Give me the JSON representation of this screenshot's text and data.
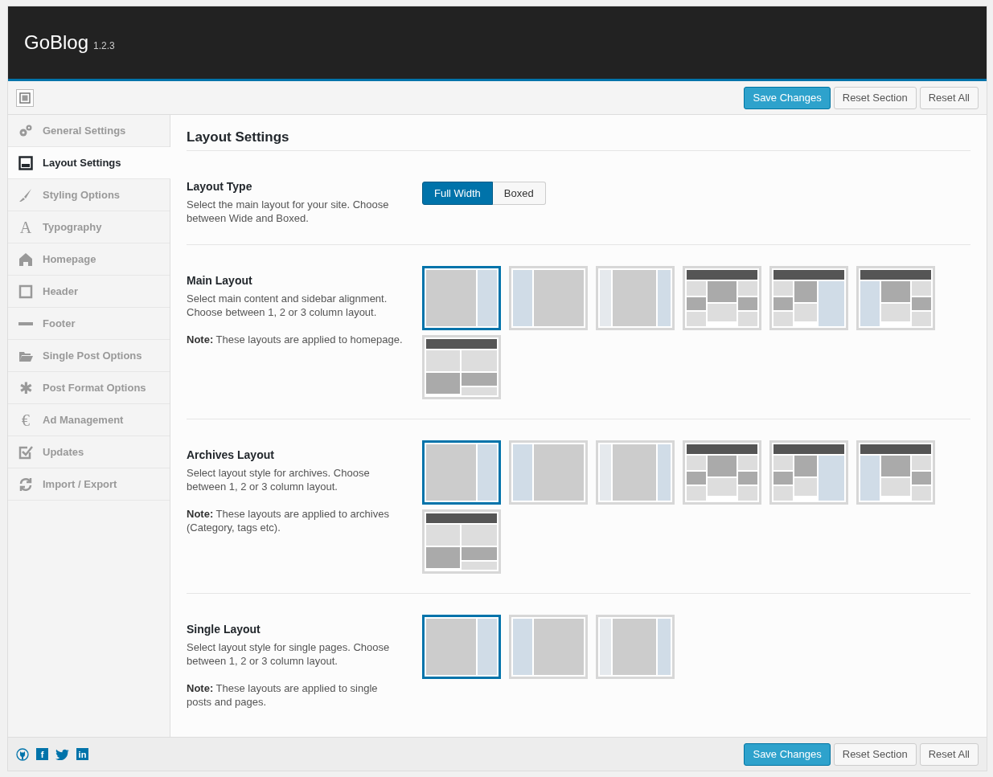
{
  "header": {
    "title": "GoBlog",
    "version": "1.2.3"
  },
  "toolbar": {
    "buttons": [
      {
        "label": "Save Changes",
        "kind": "primary"
      },
      {
        "label": "Reset Section",
        "kind": "secondary"
      },
      {
        "label": "Reset All",
        "kind": "secondary"
      }
    ]
  },
  "sidebar": {
    "items": [
      {
        "label": "General Settings",
        "kind": "gears",
        "selected": false
      },
      {
        "label": "Layout Settings",
        "kind": "layout",
        "selected": true
      },
      {
        "label": "Styling Options",
        "kind": "brush",
        "selected": false
      },
      {
        "label": "Typography",
        "kind": "glyph",
        "glyph": "A",
        "selected": false
      },
      {
        "label": "Homepage",
        "kind": "home",
        "selected": false
      },
      {
        "label": "Header",
        "kind": "square",
        "selected": false
      },
      {
        "label": "Footer",
        "kind": "minus",
        "selected": false
      },
      {
        "label": "Single Post Options",
        "kind": "folder",
        "selected": false
      },
      {
        "label": "Post Format Options",
        "kind": "glyph",
        "glyph": "✱",
        "selected": false
      },
      {
        "label": "Ad Management",
        "kind": "glyph",
        "glyph": "€",
        "selected": false
      },
      {
        "label": "Updates",
        "kind": "check",
        "selected": false
      },
      {
        "label": "Import / Export",
        "kind": "refresh",
        "selected": false
      }
    ]
  },
  "content": {
    "title": "Layout Settings",
    "sections": [
      {
        "title": "Layout Type",
        "description": "Select the main layout for your site. Choose between Wide and Boxed.",
        "kind": "toggle",
        "options": [
          {
            "label": "Full Width",
            "selected": true
          },
          {
            "label": "Boxed",
            "selected": false
          }
        ]
      },
      {
        "title": "Main Layout",
        "description": "Select main content and sidebar alignment. Choose between 1, 2 or 3 column layout.",
        "note": "**Note:** These layouts are applied to homepage.",
        "kind": "layouts",
        "options": [
          {
            "kind": "right-sidebar",
            "selected": true
          },
          {
            "kind": "left-sidebar",
            "selected": false
          },
          {
            "kind": "both-sidebars",
            "selected": false
          },
          {
            "kind": "grid-three",
            "selected": false
          },
          {
            "kind": "grid-right",
            "selected": false
          },
          {
            "kind": "grid-left",
            "selected": false
          },
          {
            "kind": "grid-two",
            "selected": false
          }
        ]
      },
      {
        "title": "Archives Layout",
        "description": "Select layout style for archives. Choose between 1, 2 or 3 column layout.",
        "note": "**Note:** These layouts are applied to archives (Category, tags etc).",
        "kind": "layouts",
        "options": [
          {
            "kind": "right-sidebar",
            "selected": true
          },
          {
            "kind": "left-sidebar",
            "selected": false
          },
          {
            "kind": "both-sidebars",
            "selected": false
          },
          {
            "kind": "grid-three",
            "selected": false
          },
          {
            "kind": "grid-right",
            "selected": false
          },
          {
            "kind": "grid-left",
            "selected": false
          },
          {
            "kind": "grid-two",
            "selected": false
          }
        ]
      },
      {
        "title": "Single Layout",
        "description": "Select layout style for single pages. Choose between 1, 2 or 3 column layout.",
        "note": "**Note:** These layouts are applied to single posts and pages.",
        "kind": "layouts",
        "options": [
          {
            "kind": "right-sidebar",
            "selected": true
          },
          {
            "kind": "left-sidebar",
            "selected": false
          },
          {
            "kind": "both-sidebars",
            "selected": false
          }
        ]
      }
    ]
  },
  "footer": {
    "social": [
      {
        "kind": "github"
      },
      {
        "kind": "facebook",
        "glyph": "f"
      },
      {
        "kind": "twitter"
      },
      {
        "kind": "linkedin",
        "glyph": "in"
      }
    ],
    "buttons": [
      {
        "label": "Save Changes",
        "kind": "primary"
      },
      {
        "label": "Reset Section",
        "kind": "secondary"
      },
      {
        "label": "Reset All",
        "kind": "secondary"
      }
    ]
  }
}
